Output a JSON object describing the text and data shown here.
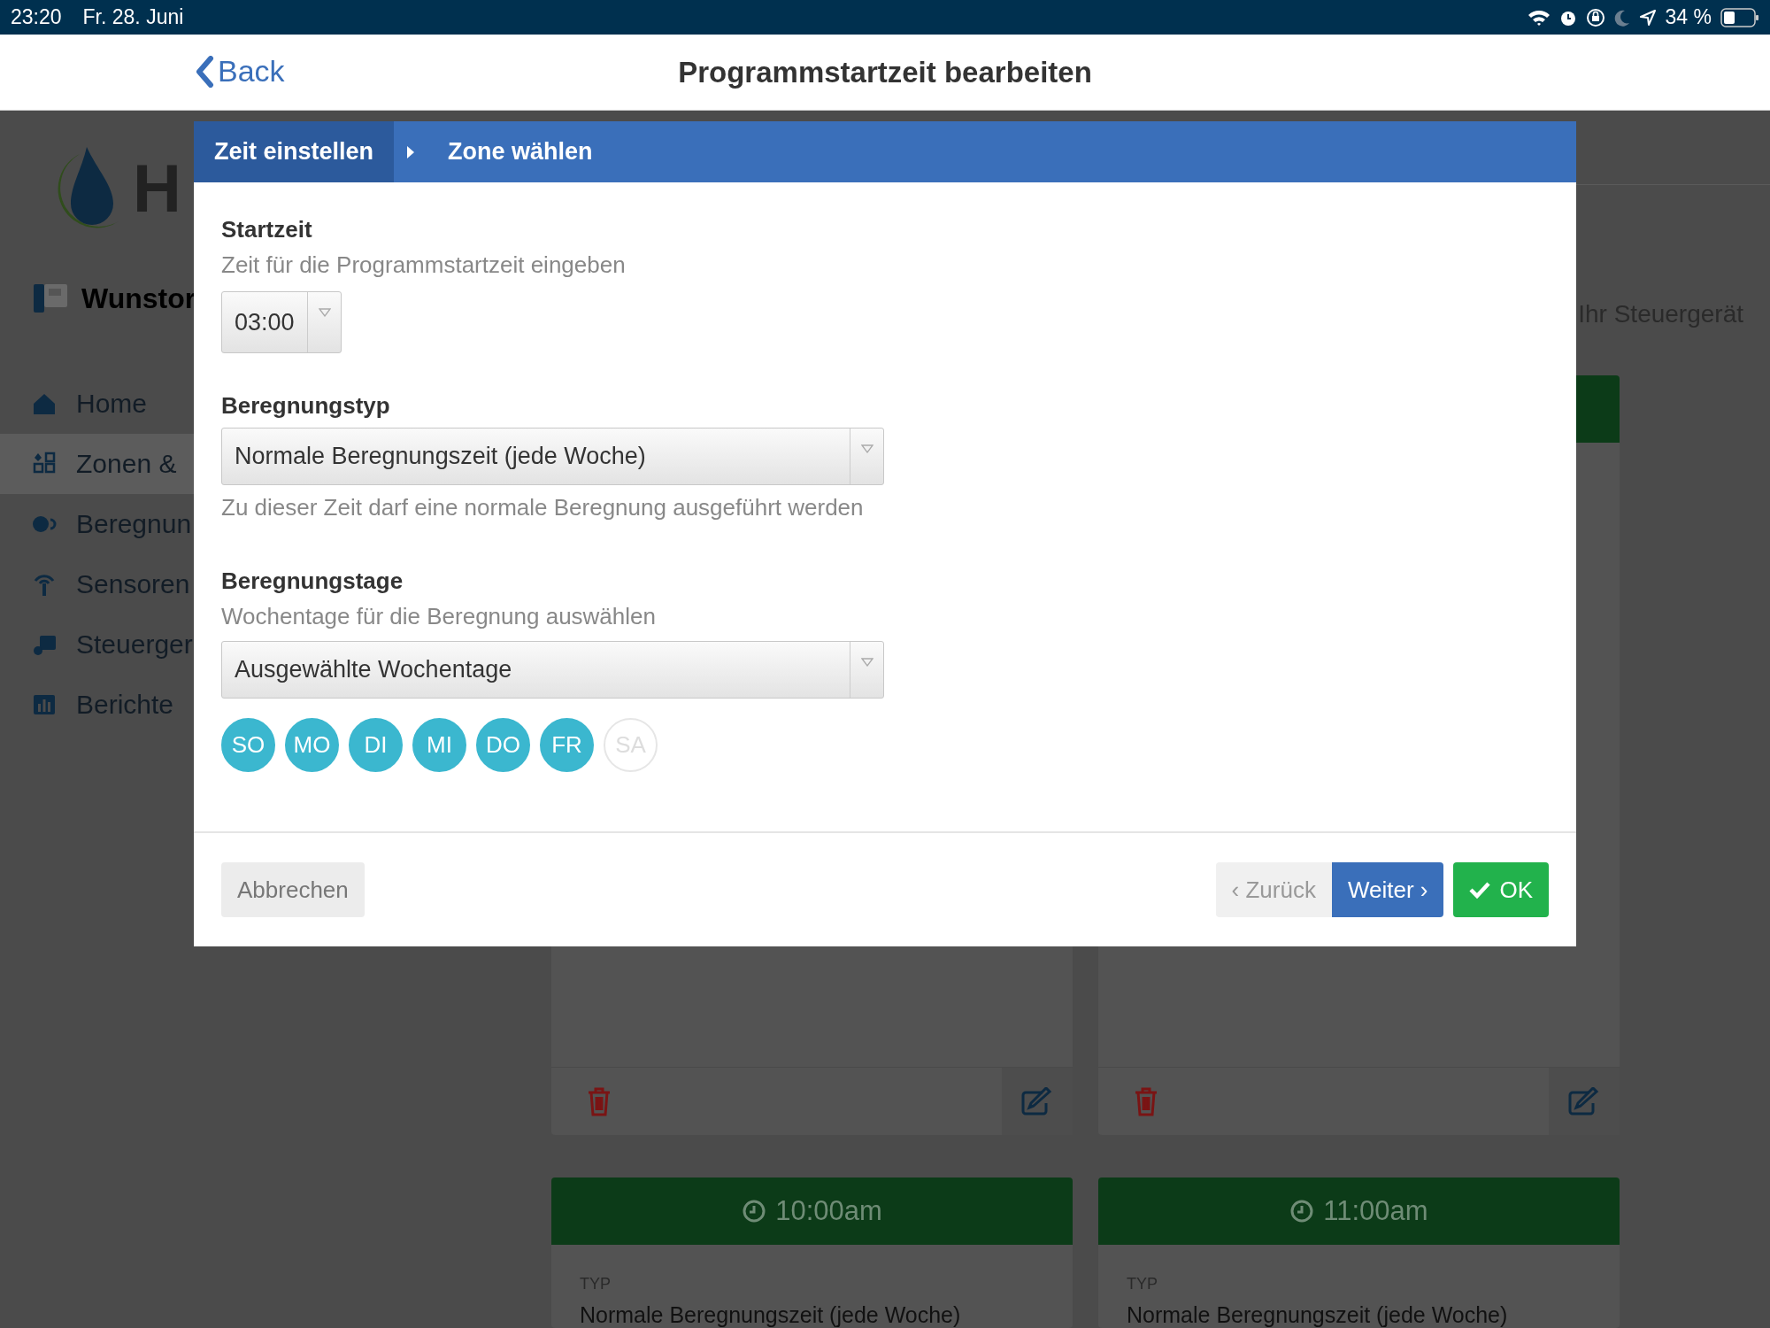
{
  "status_bar": {
    "time": "23:20",
    "date": "Fr. 28. Juni",
    "battery_text": "34 %"
  },
  "nav": {
    "back": "Back",
    "title": "Programmstartzeit bearbeiten"
  },
  "sidebar": {
    "logo_text": "H",
    "device_name": "Wunstor",
    "items": [
      {
        "label": "Home",
        "selected": false
      },
      {
        "label": "Zonen &",
        "selected": true
      },
      {
        "label": "Beregnun",
        "selected": false
      },
      {
        "label": "Sensoren",
        "selected": false
      },
      {
        "label": "Steuerger",
        "selected": false
      },
      {
        "label": "Berichte",
        "selected": false
      }
    ]
  },
  "page": {
    "caption": "Ihr Steuergerät",
    "cards": [
      {
        "kind": "lower-part"
      },
      {
        "kind": "lower-part"
      },
      {
        "kind": "full",
        "time": "10:00am",
        "type_label": "TYP",
        "type": "Normale Beregnungszeit (jede Woche)"
      },
      {
        "kind": "full",
        "time": "11:00am",
        "type_label": "TYP",
        "type": "Normale Beregnungszeit (jede Woche)"
      }
    ]
  },
  "modal": {
    "steps": [
      {
        "label": "Zeit einstellen",
        "selected": true
      },
      {
        "label": "Zone wählen",
        "selected": false
      }
    ],
    "start": {
      "label": "Startzeit",
      "hint": "Zeit für die Programmstartzeit eingeben",
      "value": "03:00"
    },
    "type": {
      "label": "Beregnungstyp",
      "value": "Normale Beregnungszeit (jede Woche)",
      "hint": "Zu dieser Zeit darf eine normale Beregnung ausgeführt werden"
    },
    "days": {
      "label": "Beregnungstage",
      "hint": "Wochentage für die Beregnung auswählen",
      "value": "Ausgewählte Wochentage",
      "items": [
        {
          "label": "SO",
          "selected": true
        },
        {
          "label": "MO",
          "selected": true
        },
        {
          "label": "DI",
          "selected": true
        },
        {
          "label": "MI",
          "selected": true
        },
        {
          "label": "DO",
          "selected": true
        },
        {
          "label": "FR",
          "selected": true
        },
        {
          "label": "SA",
          "selected": false
        }
      ]
    },
    "buttons": {
      "cancel": "Abbrechen",
      "back": {
        "label": "‹ Zurück",
        "disabled": true
      },
      "next": "Weiter ›",
      "ok": "OK"
    }
  }
}
